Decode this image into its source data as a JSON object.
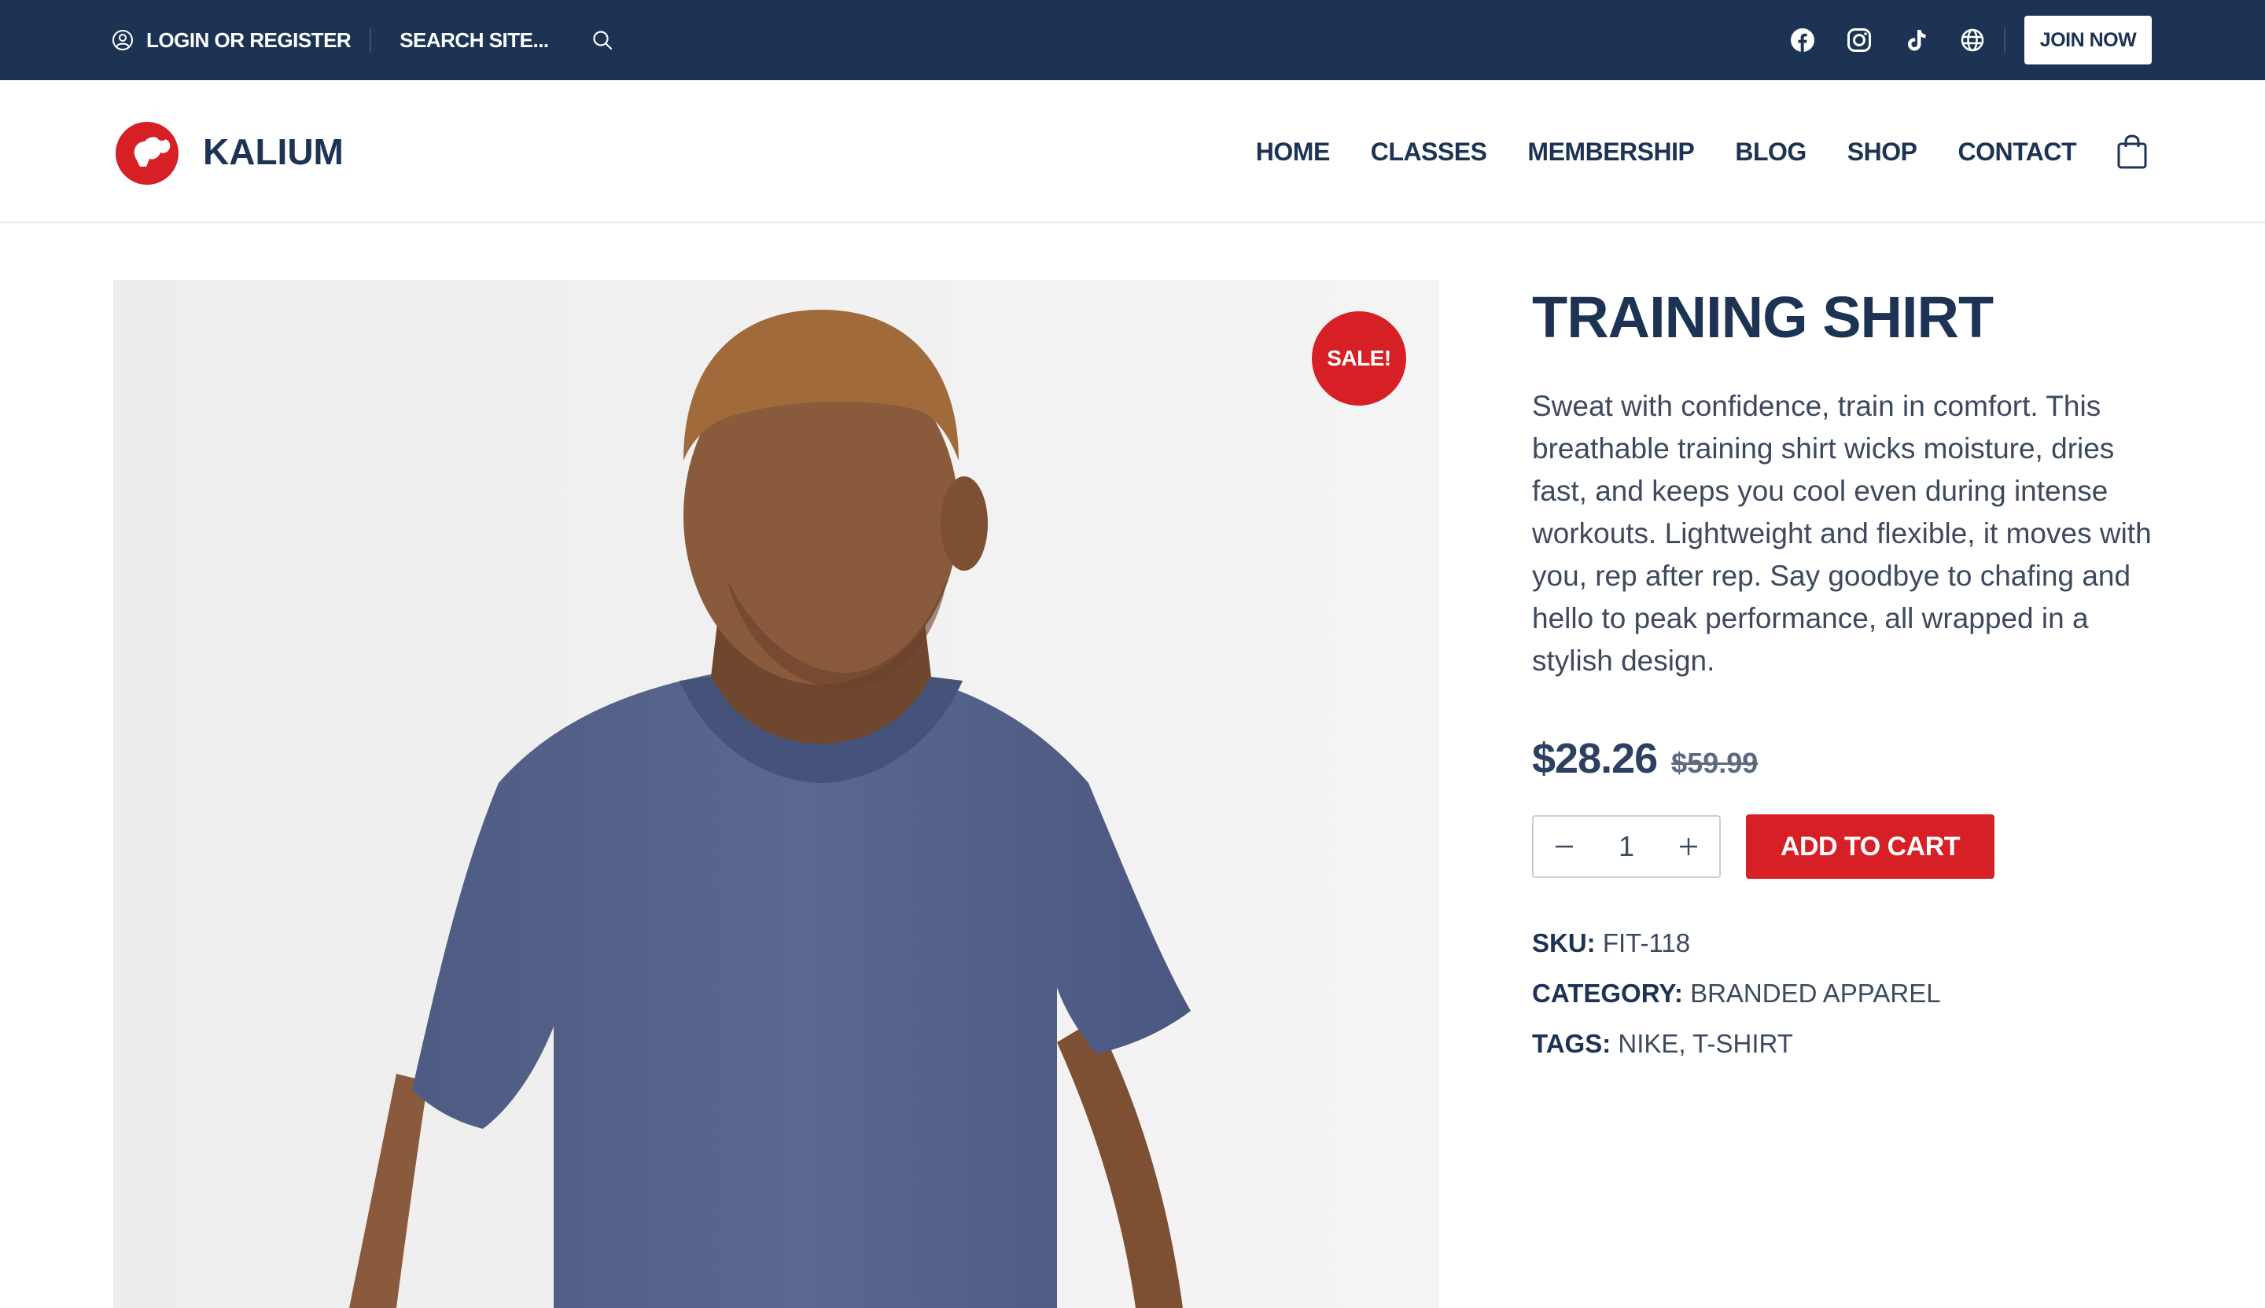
{
  "topbar": {
    "login_label": "LOGIN OR REGISTER",
    "search_placeholder": "SEARCH SITE...",
    "social_icons": [
      "facebook-icon",
      "instagram-icon",
      "tiktok-icon",
      "globe-icon"
    ],
    "join_label": "JOIN NOW"
  },
  "header": {
    "logo_text": "KALIUM",
    "nav": [
      "HOME",
      "CLASSES",
      "MEMBERSHIP",
      "BLOG",
      "SHOP",
      "CONTACT"
    ]
  },
  "product": {
    "sale_badge": "SALE!",
    "title": "TRAINING SHIRT",
    "description": "Sweat with confidence, train in comfort. This breathable training shirt wicks moisture, dries fast, and keeps you cool even during intense workouts. Lightweight and flexible, it moves with you, rep after rep. Say goodbye to chafing and hello to peak performance, all wrapped in a stylish design.",
    "price_now": "$28.26",
    "price_old": "$59.99",
    "quantity": "1",
    "add_to_cart_label": "ADD TO CART",
    "meta": {
      "sku_label": "SKU:",
      "sku_value": "FIT-118",
      "category_label": "CATEGORY:",
      "category_value": "BRANDED APPAREL",
      "tags_label": "TAGS:",
      "tags_value": "NIKE, T-SHIRT"
    }
  },
  "colors": {
    "navy": "#1d3354",
    "accent_red": "#d71f26",
    "image_bg": "#f0efef",
    "shirt": "#56648c",
    "skin": "#8a5a3c"
  }
}
